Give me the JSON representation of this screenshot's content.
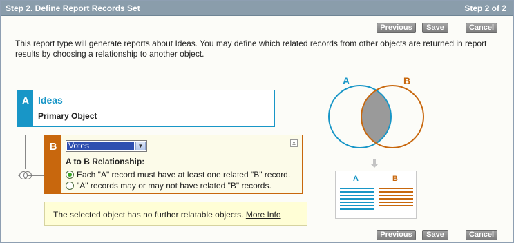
{
  "header": {
    "title": "Step 2. Define Report Records Set",
    "step": "Step 2 of 2"
  },
  "buttons": {
    "previous": "Previous",
    "save": "Save",
    "cancel": "Cancel"
  },
  "intro_text": "This report type will generate reports about Ideas. You may define which related records from other objects are returned in report results by choosing a relationship to another object.",
  "object_a": {
    "letter": "A",
    "name": "Ideas",
    "role": "Primary Object"
  },
  "object_b": {
    "letter": "B",
    "selected_object": "Votes",
    "close_label": "x",
    "relationship_heading": "A to B Relationship:",
    "options": [
      {
        "label": "Each \"A\" record must have at least one related \"B\" record.",
        "selected": true
      },
      {
        "label": "\"A\" records may or may not have related \"B\" records.",
        "selected": false
      }
    ]
  },
  "info": {
    "message": "The selected object has no further relatable objects.",
    "link": "More Info"
  },
  "venn": {
    "label_a": "A",
    "label_b": "B",
    "color_a": "#1896c7",
    "color_b": "#c8670d",
    "overlap_color": "#9a9a9a"
  },
  "result_table": {
    "col_a": "A",
    "col_b": "B"
  }
}
